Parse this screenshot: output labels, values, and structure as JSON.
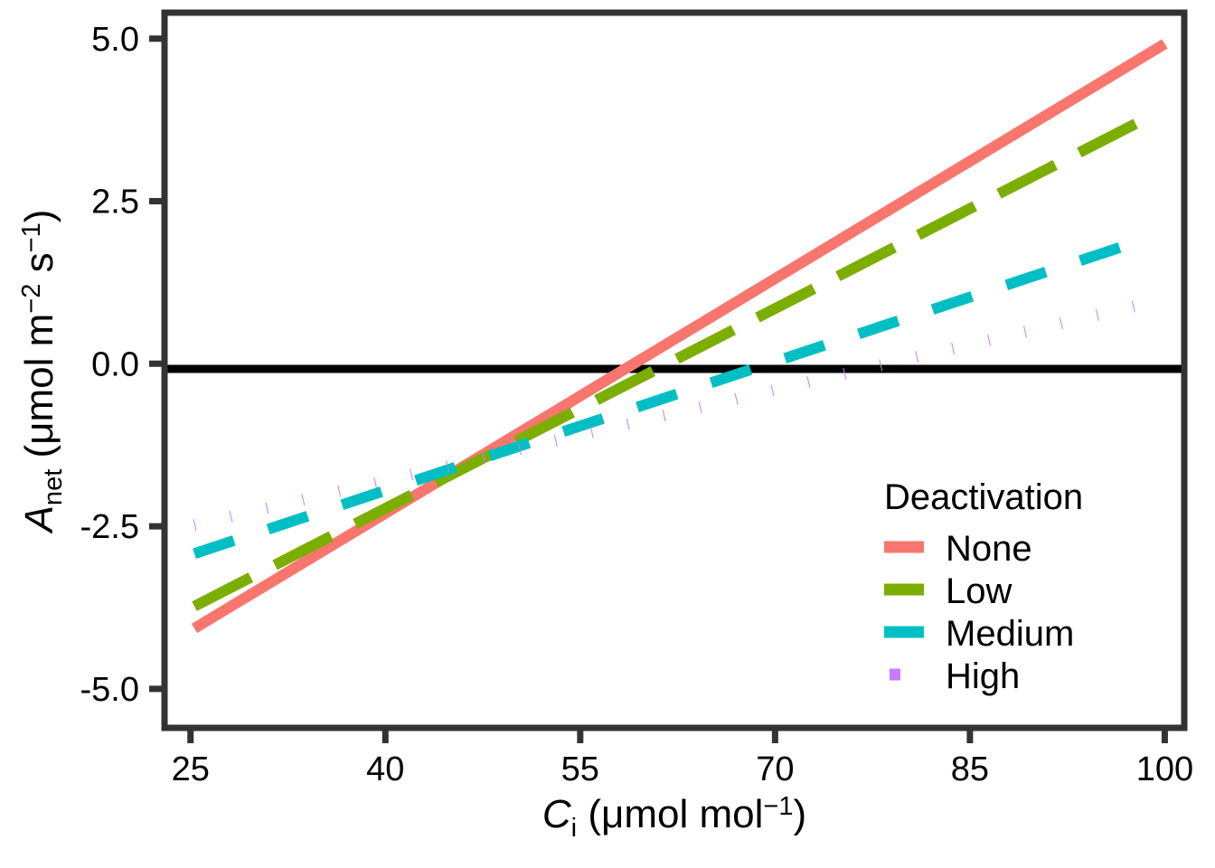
{
  "chart_data": {
    "type": "line",
    "title": "",
    "xlabel": "C_i (μmol mol⁻¹)",
    "ylabel": "A_net (μmol m⁻² s⁻¹)",
    "xlim": [
      23.0,
      101.5
    ],
    "ylim": [
      -5.6,
      5.4
    ],
    "xticks": [
      25,
      40,
      55,
      70,
      85,
      100
    ],
    "xtick_labels": [
      "25",
      "40",
      "55",
      "70",
      "85",
      "100"
    ],
    "yticks": [
      5.0,
      2.5,
      0.0,
      -2.5,
      -5.0
    ],
    "ytick_labels": [
      "5.0",
      "2.5",
      "0.0",
      "-2.5",
      "-5.0"
    ],
    "grid": false,
    "reference_lines": [
      {
        "axis": "y",
        "value": 0.0,
        "color": "#000000"
      }
    ],
    "legend_position": "inside-bottom-right",
    "series": [
      {
        "name": "None",
        "color": "#F8766D",
        "linestyle": "solid",
        "x": [
          25.3,
          100.0
        ],
        "y": [
          -4.07,
          4.92
        ]
      },
      {
        "name": "Low",
        "color": "#7CAE00",
        "linestyle": "longdash",
        "x": [
          25.3,
          99.0
        ],
        "y": [
          -3.73,
          3.82
        ]
      },
      {
        "name": "Medium",
        "color": "#00BFC4",
        "linestyle": "dashed",
        "x": [
          25.3,
          99.0
        ],
        "y": [
          -2.92,
          1.95
        ]
      },
      {
        "name": "High",
        "color": "#C77CFF",
        "linestyle": "dotted",
        "x": [
          25.3,
          98.0
        ],
        "y": [
          -2.48,
          0.9
        ]
      }
    ]
  },
  "axes": {
    "x_title_parts": {
      "base": "C",
      "sub": "i",
      "unit_open": " (μmol mol",
      "sup": "−1",
      "unit_close": ")"
    },
    "y_title_parts": {
      "base": "A",
      "sub": "net",
      "unit_open": " (μmol m",
      "sup1": "−2",
      "mid": " s",
      "sup2": "−1",
      "unit_close": ")"
    }
  },
  "legend": {
    "title": "Deactivation",
    "items": [
      {
        "label": "None",
        "color": "#F8766D",
        "style": "solid"
      },
      {
        "label": "Low",
        "color": "#7CAE00",
        "style": "longdash"
      },
      {
        "label": "Medium",
        "color": "#00BFC4",
        "style": "dashed"
      },
      {
        "label": "High",
        "color": "#C77CFF",
        "style": "dotted"
      }
    ]
  },
  "panel": {
    "border_color": "#333333",
    "background": "#FFFFFF",
    "axis_color": "#333333"
  }
}
